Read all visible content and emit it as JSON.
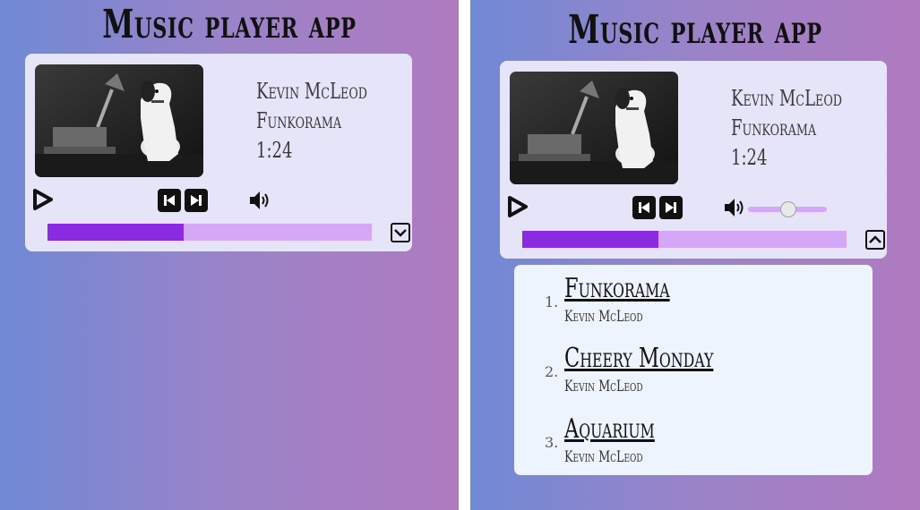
{
  "app_title": "Music player app",
  "left_view": {
    "now_playing": {
      "artist": "Kevin McLeod",
      "title": "Funkorama",
      "time": "1:24",
      "progress": 0.42
    },
    "album_art": "dog-gramophone-image",
    "controls": {
      "play": "play-icon",
      "prev": "skip-back-icon",
      "next": "skip-forward-icon",
      "volume": "volume-icon",
      "toggle": "chevron-down-icon"
    }
  },
  "right_view": {
    "now_playing": {
      "artist": "Kevin McLeod",
      "title": "Funkorama",
      "time": "1:24",
      "progress": 0.42
    },
    "album_art": "dog-gramophone-image",
    "volume_level": 0.5,
    "controls": {
      "play": "play-icon",
      "prev": "skip-back-icon",
      "next": "skip-forward-icon",
      "volume": "volume-icon",
      "toggle": "chevron-up-icon"
    },
    "playlist": [
      {
        "number": "1.",
        "title": "Funkorama",
        "artist": "Kevin McLeod"
      },
      {
        "number": "2.",
        "title": "Cheery Monday",
        "artist": "Kevin McLeod"
      },
      {
        "number": "3.",
        "title": "Aquarium",
        "artist": "Kevin McLeod"
      }
    ]
  },
  "colors": {
    "progress_fill": "#8a2be2",
    "progress_track": "#d4a8f6",
    "player_bg": "#e6e4f9",
    "playlist_bg": "#eef4fd"
  }
}
